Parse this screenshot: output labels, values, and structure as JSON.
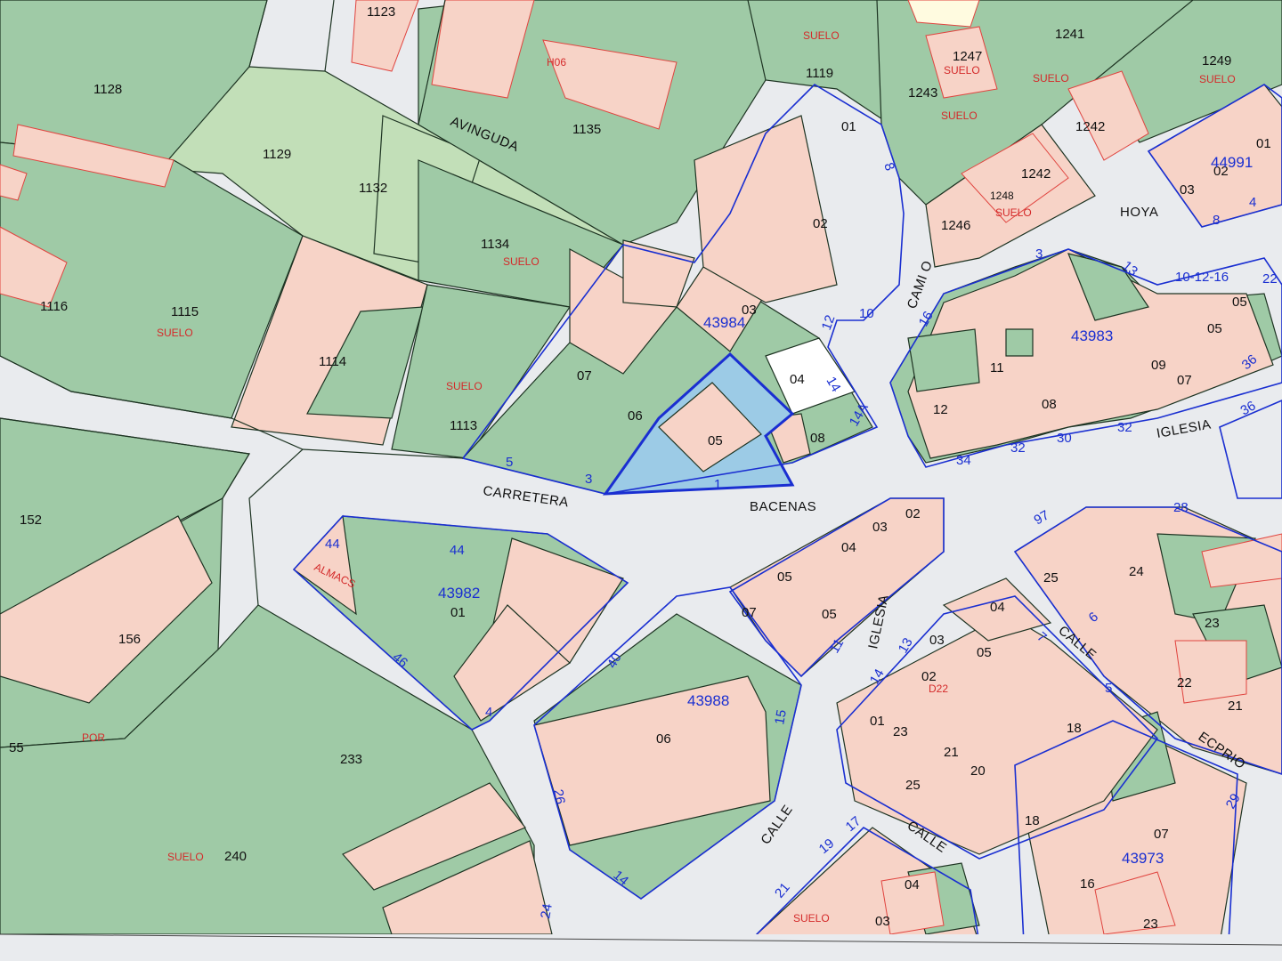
{
  "streets": {
    "avinguda": "AVINGUDA",
    "carretera": "CARRETERA",
    "bacenas": "BACENAS",
    "hoya": "HOYA",
    "camino": "CAMI O",
    "iglesia_1": "IGLESIA",
    "iglesia_2": "IGLESIA",
    "calle_1": "CALLE",
    "calle_2": "CALLE",
    "calle_3": "CALLE",
    "ecprio": "ECPRIO"
  },
  "parcels": {
    "p1123": "1123",
    "p1128": "1128",
    "p1129": "1129",
    "p1132": "1132",
    "p1135": "1135",
    "p1119": "1119",
    "p1243": "1243",
    "p1247": "1247",
    "p1241": "1241",
    "p1249": "1249",
    "p1242a": "1242",
    "p1242b": "1242",
    "p1246": "1246",
    "p1248": "1248",
    "p1134": "1134",
    "p1116": "1116",
    "p1115": "1115",
    "p1114": "1114",
    "p1113": "1113",
    "p152": "152",
    "p156": "156",
    "p233": "233",
    "p240": "240",
    "p55": "55",
    "s01a": "01",
    "s02a": "02",
    "s03a": "03",
    "s04a": "04",
    "s05a": "05",
    "s06a": "06",
    "s07a": "07",
    "s08a": "08",
    "s12": "12",
    "s11": "11",
    "s08b": "08",
    "s09": "09",
    "s07b": "07",
    "s05b": "05",
    "s01b": "01",
    "s02b": "02",
    "s03b": "03",
    "s05c": "05",
    "s04b": "04",
    "s02c": "02",
    "s03c": "03",
    "s04c": "04",
    "s05d": "05",
    "s07c": "07",
    "s05e": "05",
    "s06b": "06",
    "s01c": "01",
    "s04d": "04",
    "s03d": "03",
    "s02d": "02",
    "s05f": "05",
    "s01d": "01",
    "s23a": "23",
    "s21a": "21",
    "s20": "20",
    "s25a": "25",
    "s18a": "18",
    "s18b": "18",
    "s16": "16",
    "s07d": "07",
    "s23b": "23",
    "s25b": "25",
    "s24": "24",
    "s23c": "23",
    "s22": "22",
    "s21b": "21",
    "s04e": "04",
    "s03e": "03",
    "s06c": "06"
  },
  "blocks": {
    "b43984": "43984",
    "b43983": "43983",
    "b43982": "43982",
    "b43988": "43988",
    "b43973": "43973",
    "b44991": "44991"
  },
  "red_labels": {
    "suelo1": "SUELO",
    "suelo2": "SUELO",
    "suelo3": "SUELO",
    "suelo4": "SUELO",
    "suelo5": "SUELO",
    "suelo6": "SUELO",
    "suelo7": "SUELO",
    "suelo8": "SUELO",
    "suelo9": "SUELO",
    "suelo10": "SUELO",
    "suelo11": "SUELO",
    "almacs": "ALMACS",
    "por": "POR",
    "h06": "H06",
    "d22": "D22"
  },
  "street_numbers": {
    "n5": "5",
    "n3": "3",
    "n1": "1",
    "n44a": "44",
    "n44b": "44",
    "n46": "46",
    "n4": "4",
    "n40": "40",
    "n26": "26",
    "n14a": "14",
    "n12": "12",
    "n10": "10",
    "n8": "8",
    "n14b": "14",
    "n14c": "14A",
    "n16": "16",
    "n34": "34",
    "n32a": "32",
    "n30": "30",
    "n32b": "32",
    "n13": "13",
    "n3b": "3",
    "n101216": "10-12-16",
    "n36a": "36",
    "n36b": "36",
    "n22": "22",
    "n28": "28",
    "n97": "97",
    "n29": "29",
    "n7": "7",
    "n5b": "5",
    "n15": "15",
    "n17": "17",
    "n19": "19",
    "n21": "21",
    "n13b": "13",
    "n11": "11",
    "n14d": "14",
    "n24": "24",
    "n8b": "8",
    "n4b": "4",
    "n6": "6"
  },
  "colors": {
    "green_parcel": "#9fcaa6",
    "light_green": "#c2dfb8",
    "pink_parcel": "#f7d3c7",
    "road": "#e9ebee",
    "block_outline": "#1a2fd1",
    "parcel_outline": "#1d3322",
    "building_outline": "#e0443f",
    "highlight": "#9ccbe6"
  }
}
